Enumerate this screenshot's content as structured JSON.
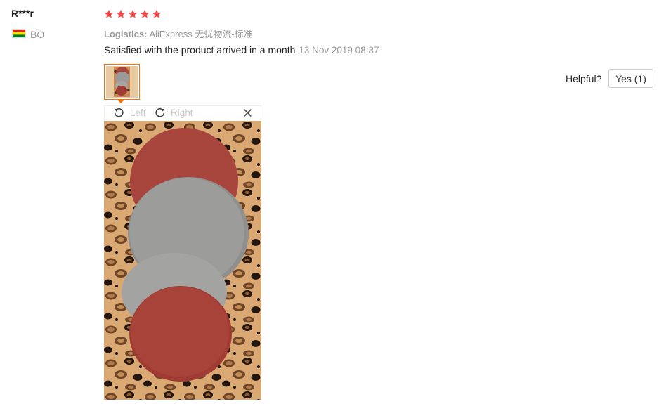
{
  "buyer": {
    "name": "R***r",
    "country_code": "BO",
    "flag_icon": "bolivia-flag-icon"
  },
  "review": {
    "rating": 5,
    "rating_max": 5,
    "star_color": "#ef4b4b",
    "logistics_label": "Logistics:",
    "logistics_value": "AliExpress 无忧物流-标准",
    "text": "Satisfied with the product arrived in a month",
    "date": "13 Nov 2019 08:37"
  },
  "helpful": {
    "label": "Helpful?",
    "yes_button": "Yes (1)"
  },
  "viewer": {
    "rotate_left_label": "Left",
    "rotate_right_label": "Right",
    "rotate_left_icon": "rotate-left-icon",
    "rotate_right_icon": "rotate-right-icon",
    "close_icon": "close-icon",
    "accent_color": "#ff7000"
  }
}
